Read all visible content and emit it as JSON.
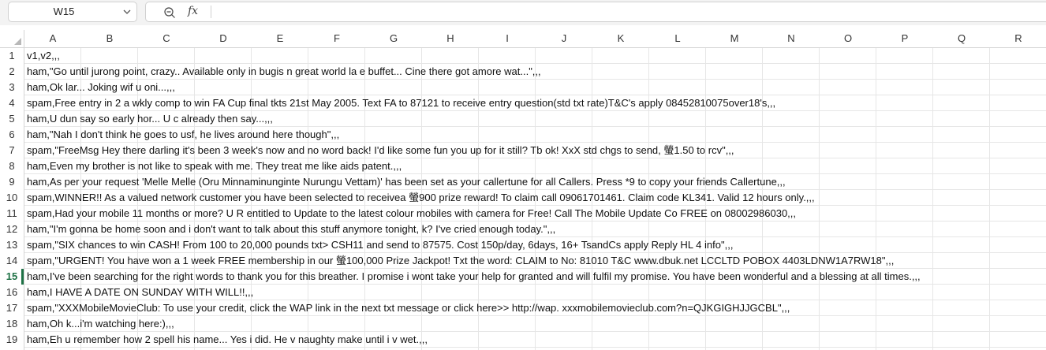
{
  "formula_bar": {
    "name_box": "W15",
    "formula_value": ""
  },
  "columns": [
    "A",
    "B",
    "C",
    "D",
    "E",
    "F",
    "G",
    "H",
    "I",
    "J",
    "K",
    "L",
    "M",
    "N",
    "O",
    "P",
    "Q",
    "R"
  ],
  "active_row": 15,
  "rows": [
    {
      "num": "1",
      "text": "v1,v2,,,"
    },
    {
      "num": "2",
      "text": "ham,\"Go until jurong point, crazy.. Available only in bugis n great world la e buffet... Cine there got amore wat...\",,,"
    },
    {
      "num": "3",
      "text": "ham,Ok lar... Joking wif u oni...,,,"
    },
    {
      "num": "4",
      "text": "spam,Free entry in 2 a wkly comp to win FA Cup final tkts 21st May 2005. Text FA to 87121 to receive entry question(std txt rate)T&C's apply 08452810075over18's,,,"
    },
    {
      "num": "5",
      "text": "ham,U dun say so early hor... U c already then say...,,,"
    },
    {
      "num": "6",
      "text": "ham,\"Nah I don't think he goes to usf, he lives around here though\",,,"
    },
    {
      "num": "7",
      "text": "spam,\"FreeMsg Hey there darling it's been 3 week's now and no word back! I'd like some fun you up for it still? Tb ok! XxX std chgs to send, 螢1.50 to rcv\",,,"
    },
    {
      "num": "8",
      "text": "ham,Even my brother is not like to speak with me. They treat me like aids patent.,,,"
    },
    {
      "num": "9",
      "text": "ham,As per your request 'Melle Melle (Oru Minnaminunginte Nurungu Vettam)' has been set as your callertune for all Callers. Press *9 to copy your friends Callertune,,,"
    },
    {
      "num": "10",
      "text": "spam,WINNER!! As a valued network customer you have been selected to receivea 螢900 prize reward! To claim call 09061701461. Claim code KL341. Valid 12 hours only.,,,"
    },
    {
      "num": "11",
      "text": "spam,Had your mobile 11 months or more? U R entitled to Update to the latest colour mobiles with camera for Free! Call The Mobile Update Co FREE on 08002986030,,,"
    },
    {
      "num": "12",
      "text": "ham,\"I'm gonna be home soon and i don't want to talk about this stuff anymore tonight, k? I've cried enough today.\",,,"
    },
    {
      "num": "13",
      "text": "spam,\"SIX chances to win CASH! From 100 to 20,000 pounds txt> CSH11 and send to 87575. Cost 150p/day, 6days, 16+ TsandCs apply Reply HL 4 info\",,,"
    },
    {
      "num": "14",
      "text": "spam,\"URGENT! You have won a 1 week FREE membership in our 螢100,000 Prize Jackpot! Txt the word: CLAIM to No: 81010 T&C www.dbuk.net LCCLTD POBOX 4403LDNW1A7RW18\",,,"
    },
    {
      "num": "15",
      "text": "ham,I've been searching for the right words to thank you for this breather. I promise i wont take your help for granted and will fulfil my promise. You have been wonderful and a blessing at all times.,,,"
    },
    {
      "num": "16",
      "text": "ham,I HAVE A DATE ON SUNDAY WITH WILL!!,,,"
    },
    {
      "num": "17",
      "text": "spam,\"XXXMobileMovieClub: To use your credit, click the WAP link in the next txt message or click here>> http://wap. xxxmobilemovieclub.com?n=QJKGIGHJJGCBL\",,,"
    },
    {
      "num": "18",
      "text": "ham,Oh k...i'm watching here:),,,"
    },
    {
      "num": "19",
      "text": "ham,Eh u remember how 2 spell his name... Yes i did. He v naughty make until i v wet.,,,"
    }
  ]
}
